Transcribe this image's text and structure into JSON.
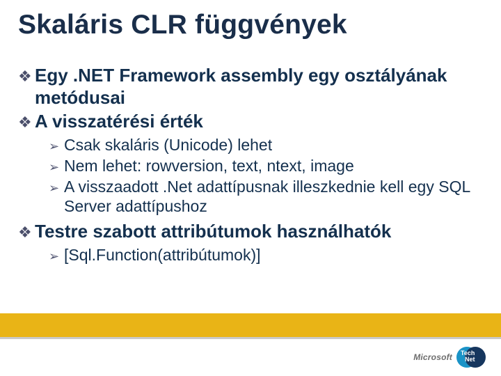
{
  "title": "Skaláris CLR függvények",
  "bullets": {
    "b1": "Egy .NET Framework assembly egy osztályának metódusai",
    "b2": "A visszatérési érték",
    "b2_sub": {
      "s1": "Csak skaláris (Unicode) lehet",
      "s2": "Nem lehet: rowversion, text, ntext, image",
      "s3": "A visszaadott .Net adattípusnak illeszkednie kell egy SQL Server adattípushoz"
    },
    "b3": "Testre szabott attribútumok használhatók",
    "b3_sub": {
      "s1": "[Sql.Function(attribútumok)]"
    }
  },
  "glyphs": {
    "diamond": "❖",
    "arrow": "➢"
  },
  "footer": {
    "brand": "Microsoft",
    "product_top": "Tech",
    "product_bottom": "Net"
  }
}
